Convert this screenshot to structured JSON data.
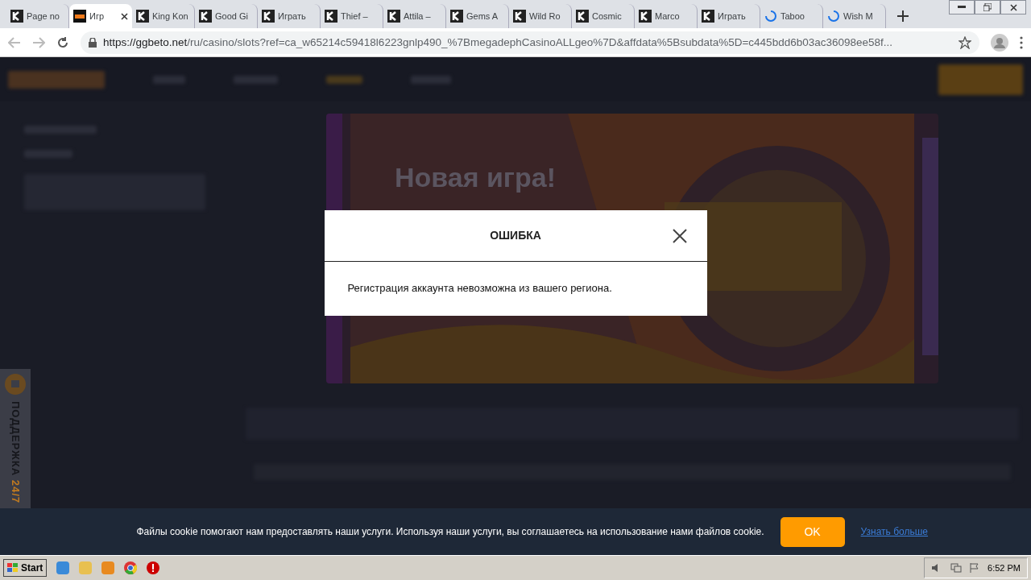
{
  "browser": {
    "tabs": [
      {
        "title": "Page no",
        "kind": "k",
        "selected": false
      },
      {
        "title": "Игр",
        "kind": "gg",
        "selected": true
      },
      {
        "title": "King Kon",
        "kind": "k",
        "selected": false
      },
      {
        "title": "Good Gi",
        "kind": "k",
        "selected": false
      },
      {
        "title": "Играть",
        "kind": "k",
        "selected": false
      },
      {
        "title": "Thief –",
        "kind": "k",
        "selected": false
      },
      {
        "title": "Attila –",
        "kind": "k",
        "selected": false
      },
      {
        "title": "Gems A",
        "kind": "k",
        "selected": false
      },
      {
        "title": "Wild Ro",
        "kind": "k",
        "selected": false
      },
      {
        "title": "Cosmic",
        "kind": "k",
        "selected": false
      },
      {
        "title": "Marco",
        "kind": "k",
        "selected": false
      },
      {
        "title": "Играть",
        "kind": "k",
        "selected": false
      },
      {
        "title": "Taboo",
        "kind": "loading",
        "selected": false
      },
      {
        "title": "Wish M",
        "kind": "loading",
        "selected": false
      }
    ],
    "url_host": "https://ggbeto.net",
    "url_path": "/ru/casino/slots?ref=ca_w65214c59418l6223gnlp490_%7BmegadephCasinoALLgeo%7D&affdata%5Bsubdata%5D=c445bdd6b03ac36098ee58f..."
  },
  "page": {
    "banner_title": "Новая игра!",
    "support": {
      "label": "ПОДДЕРЖКА",
      "hours": "24/7"
    }
  },
  "dialog": {
    "title": "ОШИБКА",
    "message": "Регистрация аккаунта невозможна из вашего региона."
  },
  "cookie_bar": {
    "text": "Файлы cookie помогают нам предоставлять наши услуги. Используя наши услуги, вы соглашаетесь на использование нами файлов cookie.",
    "button": "OK",
    "link": "Узнать больше"
  },
  "taskbar": {
    "start": "Start",
    "clock": "6:52 PM"
  }
}
